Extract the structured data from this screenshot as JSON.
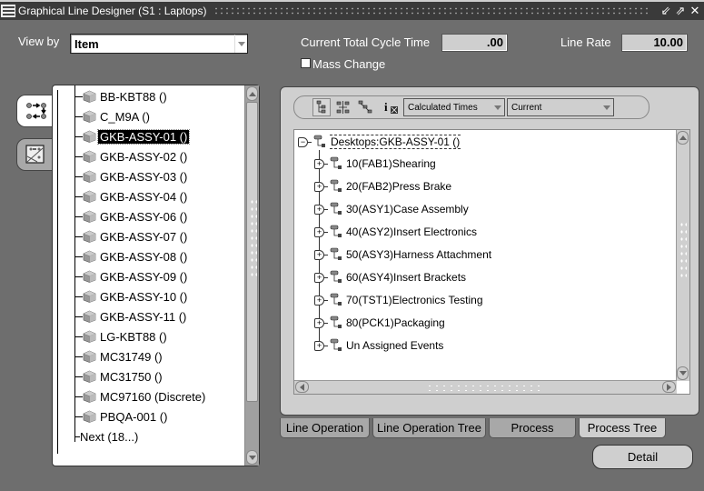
{
  "window": {
    "title": "Graphical Line Designer (S1 : Laptops)",
    "controls": [
      "minimize-icon",
      "maximize-icon",
      "close-icon"
    ]
  },
  "header": {
    "view_by_label": "View by",
    "view_by_value": "Item",
    "cycle_time_label": "Current Total Cycle Time",
    "cycle_time_value": ".00",
    "line_rate_label": "Line Rate",
    "line_rate_value": "10.00",
    "mass_change_label": "Mass Change",
    "mass_change_checked": false
  },
  "side_tabs": [
    {
      "icon": "flow-arrows-icon",
      "active": true
    },
    {
      "icon": "graph-designer-icon",
      "active": false
    }
  ],
  "item_tree": {
    "items": [
      {
        "label": "BB-KBT88 ()"
      },
      {
        "label": "C_M9A ()"
      },
      {
        "label": "GKB-ASSY-01 ()",
        "selected": true
      },
      {
        "label": "GKB-ASSY-02 ()"
      },
      {
        "label": "GKB-ASSY-03 ()"
      },
      {
        "label": "GKB-ASSY-04 ()"
      },
      {
        "label": "GKB-ASSY-06 ()"
      },
      {
        "label": "GKB-ASSY-07 ()"
      },
      {
        "label": "GKB-ASSY-08 ()"
      },
      {
        "label": "GKB-ASSY-09 ()"
      },
      {
        "label": "GKB-ASSY-10 ()"
      },
      {
        "label": "GKB-ASSY-11 ()"
      },
      {
        "label": "LG-KBT88 ()"
      },
      {
        "label": "MC31749 ()"
      },
      {
        "label": "MC31750 ()"
      },
      {
        "label": "MC97160 (Discrete)"
      },
      {
        "label": "PBQA-001 ()"
      }
    ],
    "next_label": "Next (18...)"
  },
  "toolbar": {
    "icons": [
      "vertical-tree-icon",
      "org-chart-icon",
      "diagonal-tree-icon",
      "info-icon"
    ],
    "times_select": "Calculated Times",
    "version_select": "Current"
  },
  "process_tree": {
    "root": "Desktops:GKB-ASSY-01 ()",
    "children": [
      "10(FAB1)Shearing",
      "20(FAB2)Press Brake",
      "30(ASY1)Case Assembly",
      "40(ASY2)Insert Electronics",
      "50(ASY3)Harness Attachment",
      "60(ASY4)Insert Brackets",
      "70(TST1)Electronics Testing",
      "80(PCK1)Packaging",
      "Un Assigned Events"
    ]
  },
  "bottom_tabs": [
    {
      "label": "Line Operation",
      "active": false
    },
    {
      "label": "Line Operation Tree",
      "active": false
    },
    {
      "label": "Process",
      "active": false
    },
    {
      "label": "Process Tree",
      "active": true
    }
  ],
  "detail_button": "Detail"
}
